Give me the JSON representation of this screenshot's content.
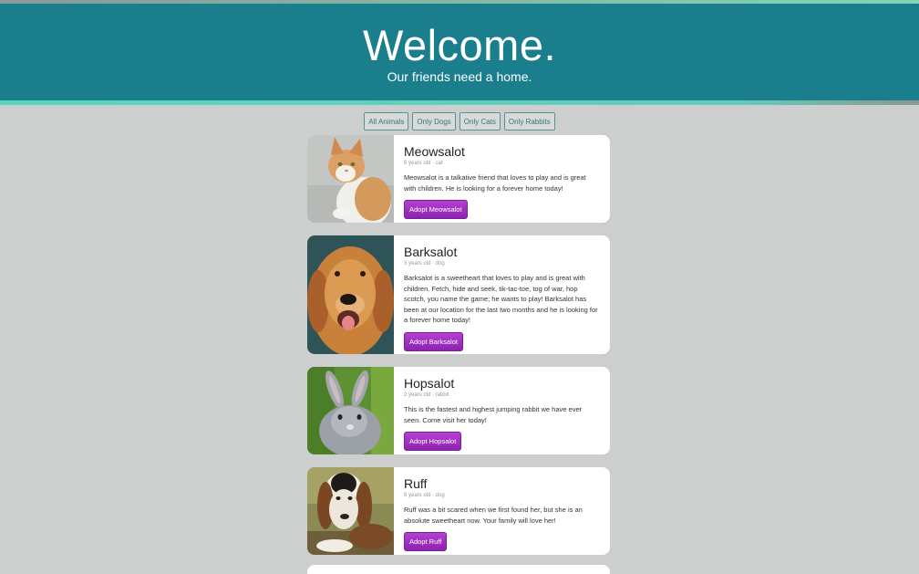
{
  "header": {
    "title": "Welcome.",
    "subtitle": "Our friends need a home."
  },
  "filters": [
    "All Animals",
    "Only Dogs",
    "Only Cats",
    "Only Rabbits"
  ],
  "pets": [
    {
      "name": "Meowsalot",
      "meta": "6 years old · cat",
      "description": "Meowsalot is a talkative friend that loves to play and is great with children. He is looking for a forever home today!",
      "adopt_label": "Adopt Meowsalot",
      "photo_icon": "cat-photo"
    },
    {
      "name": "Barksalot",
      "meta": "3 years old · dog",
      "description": "Barksalot is a sweetheart that loves to play and is great with children. Fetch, hide and seek, tik-tac-toe, tog of war, hop scotch, you name the game; he wants to play! Barksalot has been at our location for the last two months and he is looking for a forever home today!",
      "adopt_label": "Adopt Barksalot",
      "photo_icon": "golden-retriever-photo"
    },
    {
      "name": "Hopsalot",
      "meta": "2 years old · rabbit",
      "description": "This is the fastest and highest jumping rabbit we have ever seen. Come visit her today!",
      "adopt_label": "Adopt Hopsalot",
      "photo_icon": "rabbit-photo"
    },
    {
      "name": "Ruff",
      "meta": "8 years old · dog",
      "description": "Ruff was a bit scared when we first found her, but she is an absolute sweetheart now. Your family will love her!",
      "adopt_label": "Adopt Ruff",
      "photo_icon": "basset-hound-photo"
    }
  ]
}
